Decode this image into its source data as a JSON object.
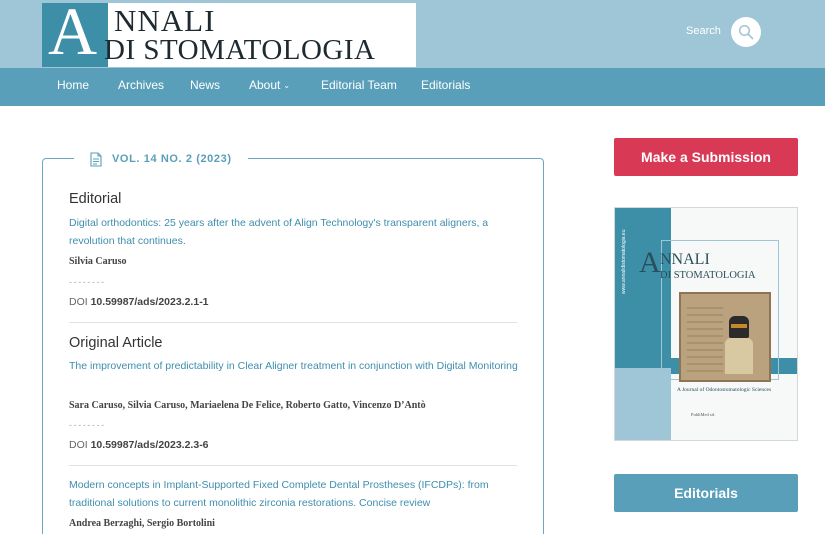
{
  "brand": {
    "logo_letter": "A",
    "logo_line1": "NNALI",
    "logo_line2": "DI STOMATOLOGIA"
  },
  "search": {
    "label": "Search",
    "icon": "search-icon"
  },
  "nav": {
    "items": [
      {
        "label": "Home"
      },
      {
        "label": "Archives"
      },
      {
        "label": "News"
      },
      {
        "label": "About",
        "has_dropdown": true
      },
      {
        "label": "Editorial Team"
      },
      {
        "label": "Editorials"
      }
    ]
  },
  "issue": {
    "icon": "document-icon",
    "title": "VOL. 14 NO. 2 (2023)",
    "sections": [
      {
        "title": "Editorial",
        "articles": [
          {
            "title": "Digital orthodontics: 25 years after the advent of Align Technology's transparent aligners, a revolution that continues.",
            "authors": "Silvia Caruso",
            "separator": "--------",
            "doi_label": "DOI",
            "doi": "10.59987/ads/2023.2.1-1"
          }
        ]
      },
      {
        "title": "Original Article",
        "articles": [
          {
            "title": "The improvement of predictability in Clear Aligner treatment in conjunction with Digital Monitoring",
            "authors": "Sara Caruso, Silvia Caruso, Mariaelena De Felice, Roberto Gatto, Vincenzo D’Antò",
            "separator": "--------",
            "doi_label": "DOI",
            "doi": "10.59987/ads/2023.2.3-6"
          },
          {
            "title": "Modern concepts in Implant-Supported Fixed Complete Dental Prostheses (IFCDPs): from traditional solutions to current monolithic zirconia restorations. Concise review",
            "authors": "Andrea Berzaghi, Sergio Bortolini"
          }
        ]
      }
    ]
  },
  "sidebar": {
    "submit_label": "Make a Submission",
    "submit_color": "#d83a55",
    "cover": {
      "letter": "A",
      "line1": "NNALI",
      "line2": "DI STOMATOLOGIA",
      "subtitle": "A Journal of Odontostomatologic Sciences",
      "publisher": "PubliMed srl.",
      "side_text": "www.annalidistomatologia.eu"
    },
    "editorials_label": "Editorials"
  },
  "colors": {
    "header_bg": "#9ec6d6",
    "nav_bg": "#5a9fb9",
    "accent": "#3f8ead",
    "submit": "#d83a55"
  }
}
